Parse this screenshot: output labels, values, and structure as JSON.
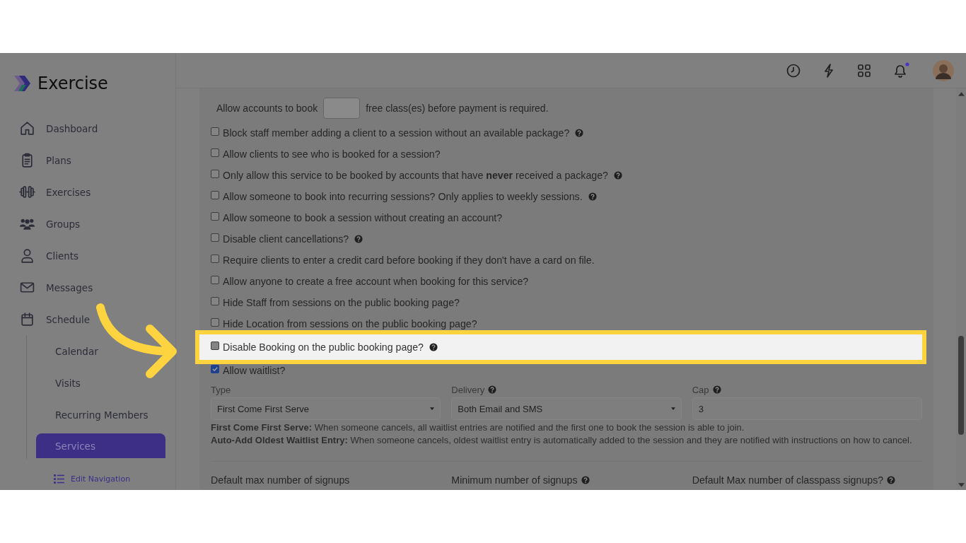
{
  "brand": {
    "name": "Exercise"
  },
  "sidebar": {
    "items": [
      {
        "label": "Dashboard",
        "selected": false
      },
      {
        "label": "Plans",
        "selected": false
      },
      {
        "label": "Exercises",
        "selected": false
      },
      {
        "label": "Groups",
        "selected": false
      },
      {
        "label": "Clients",
        "selected": false
      },
      {
        "label": "Messages",
        "selected": false
      },
      {
        "label": "Schedule",
        "selected": false,
        "children": [
          {
            "label": "Calendar",
            "selected": false
          },
          {
            "label": "Visits",
            "selected": false
          },
          {
            "label": "Recurring Members",
            "selected": false
          },
          {
            "label": "Services",
            "selected": true
          }
        ]
      }
    ],
    "edit_navigation": "Edit Navigation"
  },
  "header": {
    "notification_unread": true
  },
  "free_classes": {
    "before": "Allow accounts to book",
    "after": "free class(es) before payment is required."
  },
  "options": [
    {
      "label": "Block staff member adding a client to a session without an available package?",
      "checked": false,
      "help": true,
      "highlighted": false
    },
    {
      "label": "Allow clients to see who is booked for a session?",
      "checked": false,
      "help": false,
      "highlighted": false
    },
    {
      "label": "Only allow this service to be booked by accounts that have **never** received a package?",
      "checked": false,
      "help": true,
      "highlighted": false
    },
    {
      "label": "Allow someone to book into recurring sessions? Only applies to weekly sessions.",
      "checked": false,
      "help": true,
      "highlighted": false
    },
    {
      "label": "Allow someone to book a session without creating an account?",
      "checked": false,
      "help": false,
      "highlighted": false
    },
    {
      "label": "Disable client cancellations?",
      "checked": false,
      "help": true,
      "highlighted": false
    },
    {
      "label": "Require clients to enter a credit card before booking if they don't have a card on file.",
      "checked": false,
      "help": false,
      "highlighted": false
    },
    {
      "label": "Allow anyone to create a free account when booking for this service?",
      "checked": false,
      "help": false,
      "highlighted": false
    },
    {
      "label": "Hide Staff from sessions on the public booking page?",
      "checked": false,
      "help": false,
      "highlighted": false
    },
    {
      "label": "Hide Location from sessions on the public booking page?",
      "checked": false,
      "help": false,
      "highlighted": false
    },
    {
      "label": "Disable Booking on the public booking page?",
      "checked": false,
      "help": true,
      "highlighted": true
    },
    {
      "label": "Allow waitlist?",
      "checked": true,
      "help": false,
      "highlighted": false
    }
  ],
  "waitlist": {
    "fields": [
      {
        "label": "Type",
        "kind": "select",
        "value": "First Come First Serve",
        "help": false
      },
      {
        "label": "Delivery",
        "kind": "select",
        "value": "Both Email and SMS",
        "help": true
      },
      {
        "label": "Cap",
        "kind": "input",
        "value": "3",
        "help": true
      }
    ],
    "notes": [
      "**First Come First Serve:** When someone cancels, all waitlist entries are notified and the first one to book the session is able to join.",
      "**Auto-Add Oldest Waitlist Entry:** When someone cancels, oldest waitlist entry is automatically added to the session and they are notified with instructions on how to cancel."
    ]
  },
  "signups": [
    {
      "label": "Default max number of signups",
      "help": false
    },
    {
      "label": "Minimum number of signups",
      "help": true
    },
    {
      "label": "Default Max number of classpass signups?",
      "help": true
    }
  ]
}
